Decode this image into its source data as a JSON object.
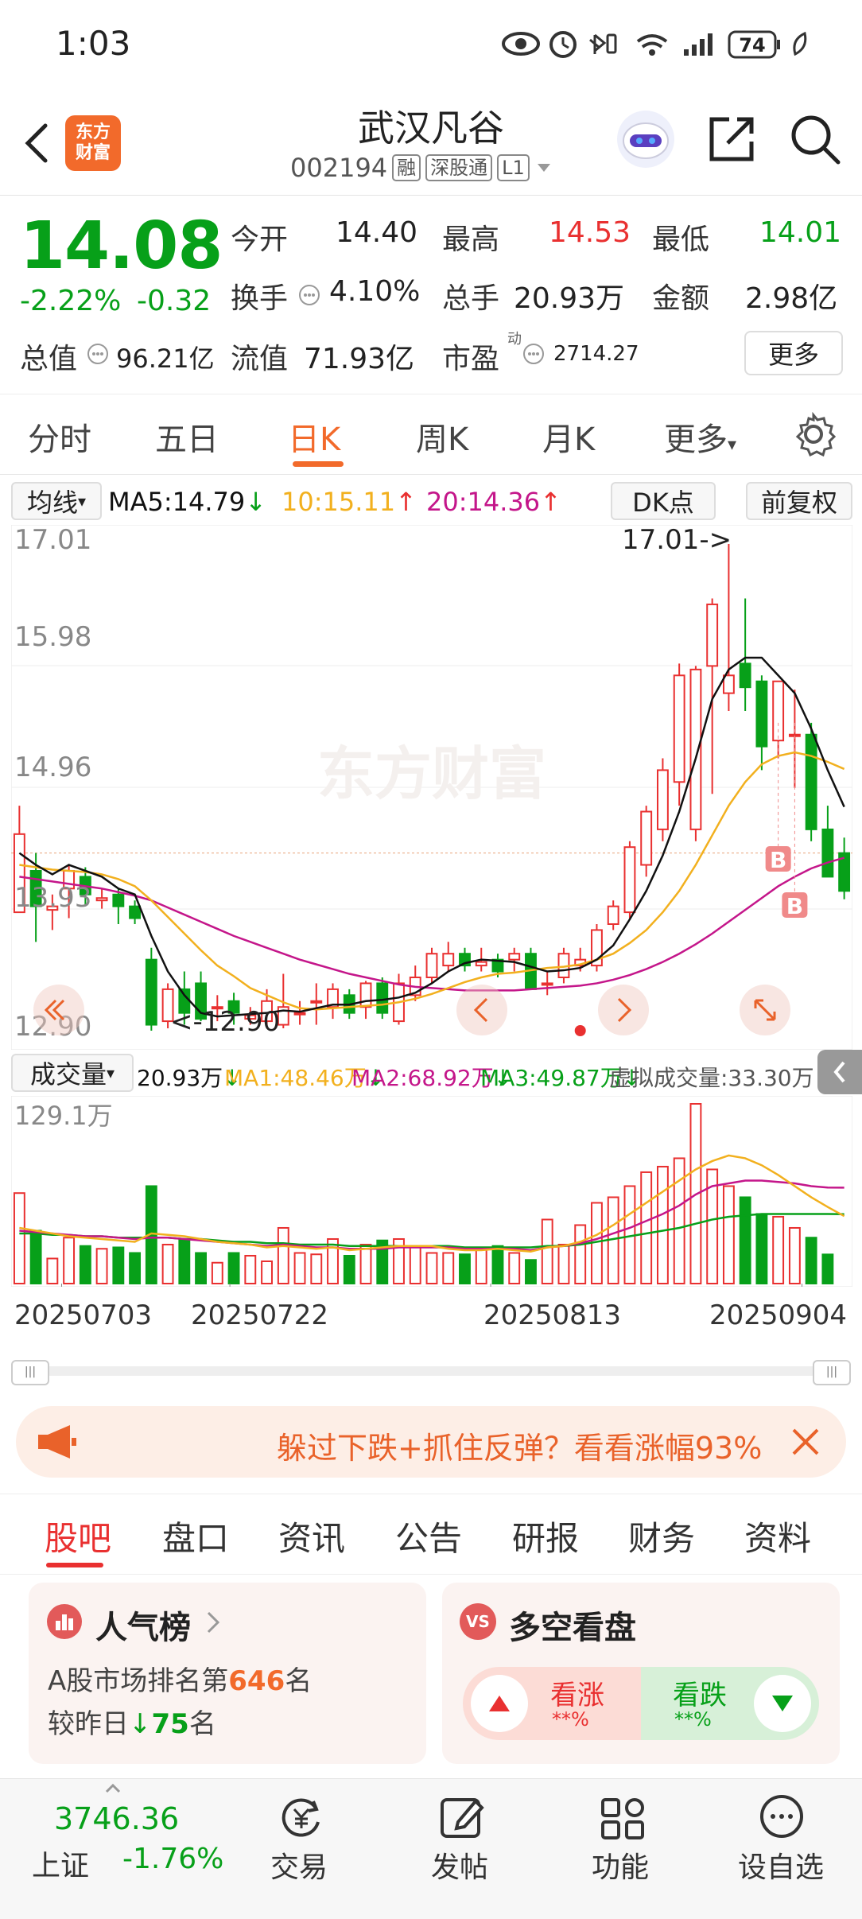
{
  "status_bar": {
    "time": "1:03",
    "battery": "74"
  },
  "header": {
    "logo_line1": "东方",
    "logo_line2": "财富",
    "stock_name": "武汉凡谷",
    "stock_code": "002194",
    "tag_margin": "融",
    "tag_connect": "深股通",
    "tag_level": "L1"
  },
  "quote": {
    "price": "14.08",
    "change_pct": "-2.22%",
    "change_amt": "-0.32",
    "open_label": "今开",
    "open": "14.40",
    "high_label": "最高",
    "high": "14.53",
    "low_label": "最低",
    "low": "14.01",
    "turnover_label": "换手",
    "turnover": "4.10%",
    "volume_label": "总手",
    "volume": "20.93万",
    "amount_label": "金额",
    "amount": "2.98亿",
    "mktcap_label": "总值",
    "mktcap": "96.21亿",
    "float_label": "流值",
    "float": "71.93亿",
    "pe_label": "市盈",
    "pe_sup": "动",
    "pe": "2714.27",
    "more_button": "更多"
  },
  "chart_tabs": [
    "分时",
    "五日",
    "日K",
    "周K",
    "月K",
    "更多"
  ],
  "ma_bar": {
    "indicator": "均线",
    "ma5": "MA5:14.79",
    "ma10": "10:15.11",
    "ma20": "20:14.36",
    "dk_button": "DK点",
    "adjust_button": "前复权"
  },
  "chart_labels": {
    "y_top": "17.01",
    "y_2": "15.98",
    "y_3": "14.96",
    "y_4": "13.93",
    "y_bottom": "12.90",
    "max_marker": "17.01->",
    "min_marker": "<-12.90",
    "buy_marker": "B",
    "watermark": "东方财富"
  },
  "volume_bar": {
    "indicator": "成交量",
    "vol": "20.93万",
    "ma1": "MA1:48.46万",
    "ma2": "MA2:68.92万",
    "ma3": "MA3:49.87万",
    "virtual": "虚拟成交量:33.30万",
    "y_max": "129.1万"
  },
  "dates": [
    "20250703",
    "20250722",
    "20250813",
    "20250904"
  ],
  "colors": {
    "up": "#e93030",
    "down": "#07a019",
    "ma5": "#111111",
    "ma10": "#f2b01e",
    "ma20": "#c4168a",
    "accent": "#f26a2b"
  },
  "chart_data": {
    "type": "candlestick",
    "dates_shown": [
      "20250703",
      "20250722",
      "20250813",
      "20250904"
    ],
    "ylim": [
      12.9,
      17.01
    ],
    "ohlc": [
      [
        13.9,
        14.8,
        14.05,
        14.56
      ],
      [
        14.25,
        14.4,
        13.65,
        13.95
      ],
      [
        13.92,
        14.05,
        13.75,
        13.95
      ],
      [
        14.1,
        14.3,
        13.85,
        14.25
      ],
      [
        14.2,
        14.28,
        13.95,
        14.05
      ],
      [
        14.0,
        14.1,
        13.93,
        14.02
      ],
      [
        14.05,
        14.1,
        13.8,
        13.95
      ],
      [
        13.95,
        14.0,
        13.8,
        13.85
      ],
      [
        13.5,
        13.6,
        12.9,
        12.95
      ],
      [
        12.98,
        13.3,
        12.92,
        13.25
      ],
      [
        13.25,
        13.4,
        12.95,
        13.05
      ],
      [
        13.3,
        13.4,
        12.98,
        13.0
      ],
      [
        13.1,
        13.2,
        12.98,
        13.1
      ],
      [
        13.15,
        13.22,
        12.95,
        13.05
      ],
      [
        13.0,
        13.1,
        12.95,
        13.03
      ],
      [
        12.98,
        13.25,
        12.95,
        13.15
      ],
      [
        12.95,
        13.38,
        12.92,
        13.1
      ],
      [
        13.05,
        13.15,
        12.95,
        13.05
      ],
      [
        13.15,
        13.3,
        12.95,
        13.15
      ],
      [
        13.1,
        13.3,
        13.0,
        13.25
      ],
      [
        13.2,
        13.25,
        13.0,
        13.05
      ],
      [
        13.1,
        13.32,
        13.0,
        13.3
      ],
      [
        13.3,
        13.35,
        13.0,
        13.05
      ],
      [
        12.98,
        13.38,
        12.95,
        13.3
      ],
      [
        13.2,
        13.45,
        13.15,
        13.35
      ],
      [
        13.35,
        13.6,
        13.3,
        13.55
      ],
      [
        13.45,
        13.65,
        13.4,
        13.55
      ],
      [
        13.55,
        13.6,
        13.4,
        13.45
      ],
      [
        13.45,
        13.6,
        13.4,
        13.48
      ],
      [
        13.5,
        13.55,
        13.35,
        13.4
      ],
      [
        13.5,
        13.6,
        13.4,
        13.55
      ],
      [
        13.55,
        13.6,
        13.3,
        13.25
      ],
      [
        13.3,
        13.4,
        13.2,
        13.3
      ],
      [
        13.35,
        13.6,
        13.3,
        13.55
      ],
      [
        13.45,
        13.6,
        13.4,
        13.5
      ],
      [
        13.45,
        13.8,
        13.4,
        13.75
      ],
      [
        13.8,
        14.0,
        13.75,
        13.95
      ],
      [
        13.9,
        14.5,
        13.85,
        14.45
      ],
      [
        14.3,
        14.8,
        14.2,
        14.75
      ],
      [
        14.6,
        15.2,
        14.5,
        15.1
      ],
      [
        15.0,
        16.0,
        14.8,
        15.9
      ],
      [
        14.6,
        15.98,
        14.5,
        15.95
      ],
      [
        15.98,
        16.55,
        14.9,
        16.5
      ],
      [
        15.75,
        17.01,
        15.6,
        15.9
      ],
      [
        16.0,
        16.55,
        15.6,
        15.8
      ],
      [
        15.85,
        15.9,
        15.1,
        15.3
      ],
      [
        15.35,
        15.85,
        15.2,
        15.85
      ],
      [
        15.4,
        15.78,
        14.95,
        15.4
      ],
      [
        15.4,
        15.5,
        14.5,
        14.6
      ],
      [
        14.6,
        14.8,
        14.3,
        14.2
      ],
      [
        14.4,
        14.53,
        14.01,
        14.08
      ]
    ],
    "ma5": [
      14.4,
      14.3,
      14.22,
      14.3,
      14.25,
      14.2,
      14.1,
      14.05,
      13.7,
      13.4,
      13.2,
      13.05,
      13.02,
      13.03,
      13.04,
      13.05,
      13.07,
      13.06,
      13.09,
      13.12,
      13.12,
      13.15,
      13.16,
      13.18,
      13.22,
      13.3,
      13.4,
      13.47,
      13.5,
      13.49,
      13.48,
      13.44,
      13.4,
      13.41,
      13.43,
      13.5,
      13.62,
      13.84,
      14.08,
      14.38,
      14.75,
      15.2,
      15.7,
      15.95,
      16.05,
      16.05,
      15.9,
      15.75,
      15.45,
      15.1,
      14.79
    ],
    "ma10": [
      14.3,
      14.28,
      14.26,
      14.25,
      14.24,
      14.22,
      14.18,
      14.12,
      14.0,
      13.86,
      13.72,
      13.58,
      13.45,
      13.36,
      13.26,
      13.2,
      13.14,
      13.09,
      13.08,
      13.09,
      13.1,
      13.11,
      13.12,
      13.14,
      13.17,
      13.21,
      13.26,
      13.31,
      13.35,
      13.38,
      13.39,
      13.41,
      13.43,
      13.44,
      13.46,
      13.5,
      13.55,
      13.64,
      13.75,
      13.9,
      14.08,
      14.3,
      14.55,
      14.8,
      15.0,
      15.15,
      15.22,
      15.25,
      15.22,
      15.17,
      15.11
    ],
    "ma20": [
      14.2,
      14.18,
      14.16,
      14.14,
      14.12,
      14.1,
      14.07,
      14.04,
      14.0,
      13.94,
      13.88,
      13.82,
      13.76,
      13.7,
      13.65,
      13.6,
      13.55,
      13.5,
      13.46,
      13.42,
      13.38,
      13.35,
      13.32,
      13.29,
      13.27,
      13.26,
      13.25,
      13.24,
      13.24,
      13.24,
      13.24,
      13.25,
      13.26,
      13.27,
      13.28,
      13.3,
      13.33,
      13.37,
      13.42,
      13.48,
      13.55,
      13.63,
      13.72,
      13.82,
      13.92,
      14.02,
      14.12,
      14.2,
      14.27,
      14.32,
      14.36
    ],
    "volume_ylim": [
      0,
      129.1
    ],
    "volume": [
      65,
      38,
      18,
      33,
      27,
      25,
      26,
      22,
      70,
      28,
      32,
      22,
      15,
      22,
      20,
      16,
      40,
      22,
      21,
      32,
      20,
      28,
      31,
      32,
      26,
      22,
      22,
      21,
      26,
      27,
      22,
      17,
      46,
      28,
      42,
      58,
      62,
      70,
      80,
      84,
      90,
      129.1,
      82,
      70,
      62,
      50,
      48,
      40,
      33,
      20.93
    ],
    "vol_ma1": [
      40,
      38,
      36,
      34,
      33,
      32,
      31,
      30,
      36,
      35,
      34,
      32,
      30,
      29,
      28,
      26,
      27,
      26,
      25,
      26,
      24,
      25,
      26,
      27,
      27,
      27,
      25,
      24,
      24,
      25,
      24,
      23,
      26,
      27,
      30,
      35,
      42,
      50,
      58,
      66,
      74,
      82,
      88,
      92,
      90,
      85,
      78,
      70,
      62,
      55,
      48.46
    ],
    "vol_ma2": [
      38,
      37,
      36,
      35,
      34,
      34,
      33,
      32,
      33,
      33,
      32,
      31,
      30,
      29,
      28,
      27,
      28,
      27,
      26,
      26,
      25,
      25,
      25,
      26,
      26,
      26,
      26,
      25,
      25,
      25,
      25,
      24,
      26,
      27,
      29,
      32,
      36,
      40,
      45,
      50,
      56,
      64,
      70,
      72,
      74,
      74,
      73,
      72,
      70,
      69,
      68.92
    ],
    "vol_ma3": [
      36,
      36,
      35,
      35,
      34,
      34,
      33,
      33,
      33,
      33,
      32,
      32,
      31,
      30,
      30,
      29,
      29,
      28,
      28,
      28,
      27,
      27,
      27,
      27,
      27,
      27,
      27,
      26,
      26,
      26,
      26,
      26,
      27,
      27,
      28,
      30,
      32,
      34,
      36,
      38,
      40,
      43,
      46,
      48,
      49,
      50,
      50,
      50,
      50,
      50,
      49.87
    ]
  },
  "banner": {
    "text": "躲过下跌+抓住反弹？看看涨幅93%"
  },
  "bottom_tabs": [
    "股吧",
    "盘口",
    "资讯",
    "公告",
    "研报",
    "财务",
    "资料"
  ],
  "popularity_card": {
    "title": "人气榜",
    "rank_prefix": "A股市场排名第",
    "rank": "646",
    "rank_suffix": "名",
    "compare_prefix": "较昨日",
    "compare_value": "75",
    "compare_suffix": "名"
  },
  "sentiment_card": {
    "title": "多空看盘",
    "badge": "VS",
    "bull_label": "看涨",
    "bull_value": "**%",
    "bear_label": "看跌",
    "bear_value": "**%"
  },
  "bottom_nav": {
    "index_value": "3746.36",
    "index_name": "上证",
    "index_change": "-1.76%",
    "items": [
      "交易",
      "发帖",
      "功能",
      "设自选"
    ]
  }
}
